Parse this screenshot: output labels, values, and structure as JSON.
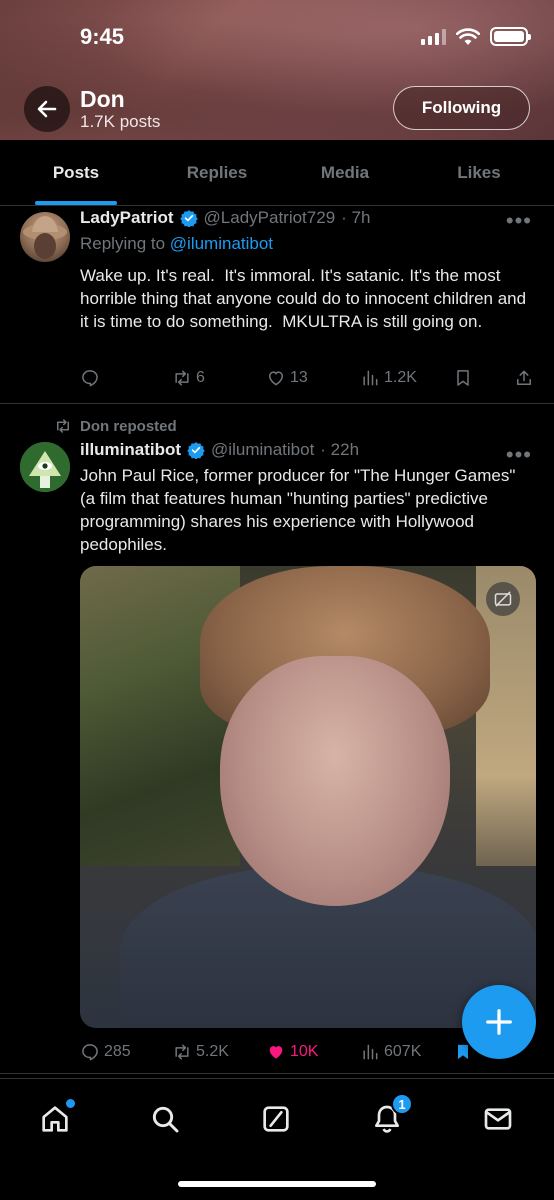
{
  "status_bar": {
    "time": "9:45"
  },
  "header": {
    "name": "Don",
    "post_count": "1.7K posts",
    "follow_label": "Following"
  },
  "tabs": [
    {
      "label": "Posts",
      "active": true
    },
    {
      "label": "Replies",
      "active": false
    },
    {
      "label": "Media",
      "active": false
    },
    {
      "label": "Likes",
      "active": false
    }
  ],
  "tweet1": {
    "name": "LadyPatriot",
    "handle": "@LadyPatriot729",
    "time": "· 7h",
    "replying_prefix": "Replying to ",
    "replying_handle": "@iluminatibot",
    "text": "Wake up. It's real.  It's immoral. It's satanic. It's the most horrible thing that anyone could do to innocent children and it is time to do something.  MKULTRA is still going on.",
    "reposts": "6",
    "likes": "13",
    "views": "1.2K"
  },
  "tweet2": {
    "repost_label": "Don reposted",
    "name": "illuminatibot",
    "handle": "@iluminatibot",
    "time": "· 22h",
    "text": "John Paul Rice, former producer for \"The Hunger Games\" (a film that features human \"hunting parties\" predictive programming) shares his experience with Hollywood pedophiles.",
    "replies": "285",
    "reposts": "5.2K",
    "likes": "10K",
    "views": "607K"
  },
  "nav": {
    "notification_count": "1"
  },
  "colors": {
    "accent": "#1d9bf0",
    "like": "#f91880",
    "muted": "#71767b"
  }
}
